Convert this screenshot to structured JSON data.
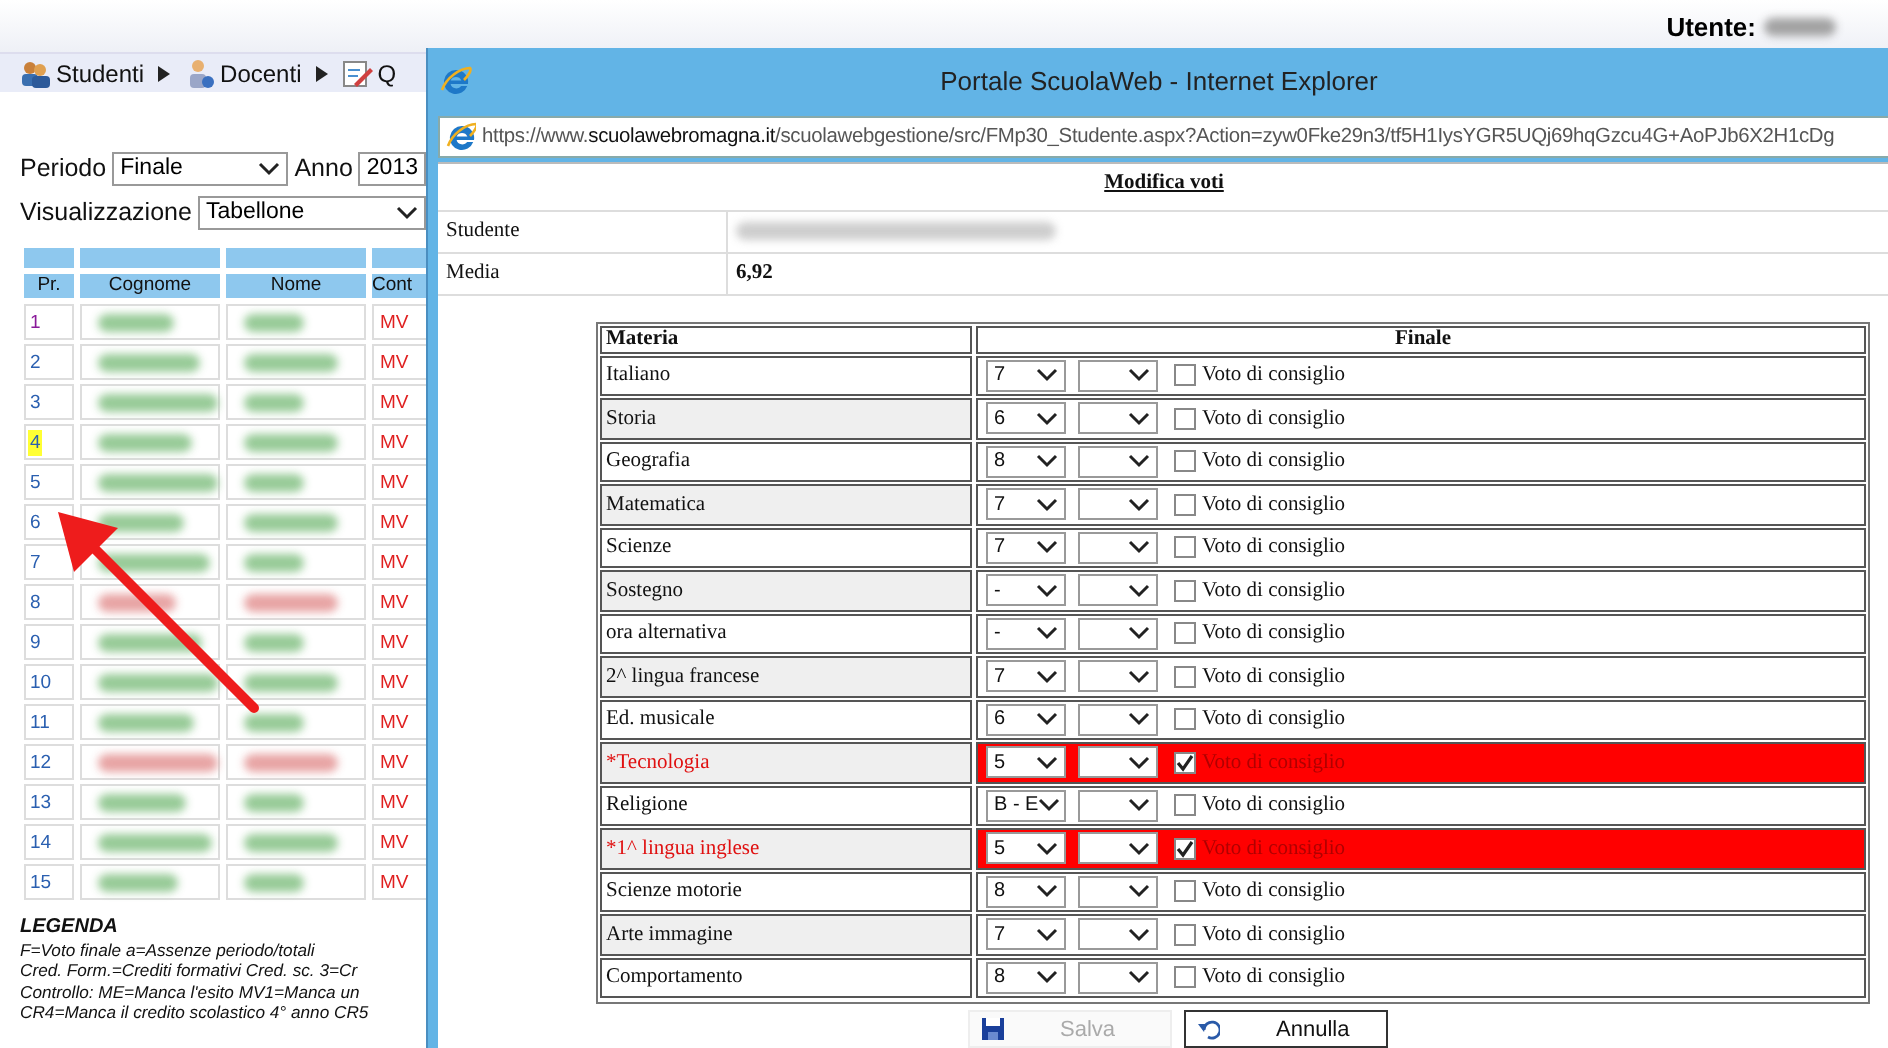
{
  "header": {
    "user_label": "Utente:"
  },
  "menu": [
    {
      "label": "Studenti",
      "submenu": true
    },
    {
      "label": "Docenti",
      "submenu": true
    },
    {
      "label": "Q",
      "submenu": false
    }
  ],
  "filters": [
    {
      "label": "Periodo",
      "value": "Finale"
    },
    {
      "label": "Anno",
      "value": "2013"
    },
    {
      "label": "Visualizzazione",
      "value": "Tabellone"
    }
  ],
  "students_table": {
    "columns": [
      "Pr.",
      "Cognome",
      "Nome",
      "Cont"
    ],
    "rows": [
      {
        "number": "1",
        "visited": true,
        "selected": false,
        "color": "#8cc58c",
        "control": "MV"
      },
      {
        "number": "2",
        "visited": false,
        "selected": false,
        "color": "#8cc58c",
        "control": "MV"
      },
      {
        "number": "3",
        "visited": false,
        "selected": false,
        "color": "#8cc58c",
        "control": "MV"
      },
      {
        "number": "4",
        "visited": false,
        "selected": true,
        "color": "#8cc58c",
        "control": "MV"
      },
      {
        "number": "5",
        "visited": false,
        "selected": false,
        "color": "#8cc58c",
        "control": "MV"
      },
      {
        "number": "6",
        "visited": false,
        "selected": false,
        "color": "#8cc58c",
        "control": "MV"
      },
      {
        "number": "7",
        "visited": false,
        "selected": false,
        "color": "#8cc58c",
        "control": "MV"
      },
      {
        "number": "8",
        "visited": false,
        "selected": false,
        "color": "#e59a9a",
        "control": "MV"
      },
      {
        "number": "9",
        "visited": false,
        "selected": false,
        "color": "#8cc58c",
        "control": "MV"
      },
      {
        "number": "10",
        "visited": false,
        "selected": false,
        "color": "#8cc58c",
        "control": "MV"
      },
      {
        "number": "11",
        "visited": false,
        "selected": false,
        "color": "#8cc58c",
        "control": "MV"
      },
      {
        "number": "12",
        "visited": false,
        "selected": false,
        "color": "#e59a9a",
        "control": "MV"
      },
      {
        "number": "13",
        "visited": false,
        "selected": false,
        "color": "#8cc58c",
        "control": "MV"
      },
      {
        "number": "14",
        "visited": false,
        "selected": false,
        "color": "#8cc58c",
        "control": "MV"
      },
      {
        "number": "15",
        "visited": false,
        "selected": false,
        "color": "#8cc58c",
        "control": "MV"
      }
    ]
  },
  "legend": {
    "title": "LEGENDA",
    "lines": [
      "F=Voto finale a=Assenze periodo/totali",
      "Cred. Form.=Crediti formativi Cred. sc. 3=Cr",
      "Controllo: ME=Manca l'esito MV1=Manca un",
      "CR4=Manca il credito scolastico 4° anno CR5"
    ]
  },
  "popup": {
    "title": "Portale ScuolaWeb - Internet Explorer",
    "url": "https://www.**scuolawebromagna.it**/scuolawebgestione/src/FMp30_Studente.aspx?Action=zyw0Fke29n3/tf5H1IysYGR5UQj69hqGzcu4G+AoPJb6X2H1cDg",
    "heading": "Modifica voti",
    "info": [
      {
        "label": "Studente",
        "kind": "redacted"
      },
      {
        "label": "Media",
        "kind": "value",
        "value": "6,92"
      }
    ],
    "grades": {
      "columns": [
        "Materia",
        "Finale"
      ],
      "rows": [
        {
          "subject": "Italiano",
          "grade": "7",
          "checkbox_label": "Voto di consiglio",
          "checked": false,
          "flagged": false
        },
        {
          "subject": "Storia",
          "grade": "6",
          "checkbox_label": "Voto di consiglio",
          "checked": false,
          "flagged": false
        },
        {
          "subject": "Geografia",
          "grade": "8",
          "checkbox_label": "Voto di consiglio",
          "checked": false,
          "flagged": false
        },
        {
          "subject": "Matematica",
          "grade": "7",
          "checkbox_label": "Voto di consiglio",
          "checked": false,
          "flagged": false
        },
        {
          "subject": "Scienze",
          "grade": "7",
          "checkbox_label": "Voto di consiglio",
          "checked": false,
          "flagged": false
        },
        {
          "subject": "Sostegno",
          "grade": "-",
          "checkbox_label": "Voto di consiglio",
          "checked": false,
          "flagged": false
        },
        {
          "subject": "ora alternativa",
          "grade": "-",
          "checkbox_label": "Voto di consiglio",
          "checked": false,
          "flagged": false
        },
        {
          "subject": "2^ lingua francese",
          "grade": "7",
          "checkbox_label": "Voto di consiglio",
          "checked": false,
          "flagged": false
        },
        {
          "subject": "Ed. musicale",
          "grade": "6",
          "checkbox_label": "Voto di consiglio",
          "checked": false,
          "flagged": false
        },
        {
          "subject": "*Tecnologia",
          "grade": "5",
          "checkbox_label": "Voto di consiglio",
          "checked": true,
          "flagged": true
        },
        {
          "subject": "Religione",
          "grade": "B - E",
          "checkbox_label": "Voto di consiglio",
          "checked": false,
          "flagged": false
        },
        {
          "subject": "*1^ lingua inglese",
          "grade": "5",
          "checkbox_label": "Voto di consiglio",
          "checked": true,
          "flagged": true
        },
        {
          "subject": "Scienze motorie",
          "grade": "8",
          "checkbox_label": "Voto di consiglio",
          "checked": false,
          "flagged": false
        },
        {
          "subject": "Arte immagine",
          "grade": "7",
          "checkbox_label": "Voto di consiglio",
          "checked": false,
          "flagged": false
        },
        {
          "subject": "Comportamento",
          "grade": "8",
          "checkbox_label": "Voto di consiglio",
          "checked": false,
          "flagged": false
        }
      ]
    },
    "buttons": [
      {
        "label": "Salva",
        "disabled": true
      },
      {
        "label": "Annulla",
        "disabled": false
      }
    ]
  }
}
